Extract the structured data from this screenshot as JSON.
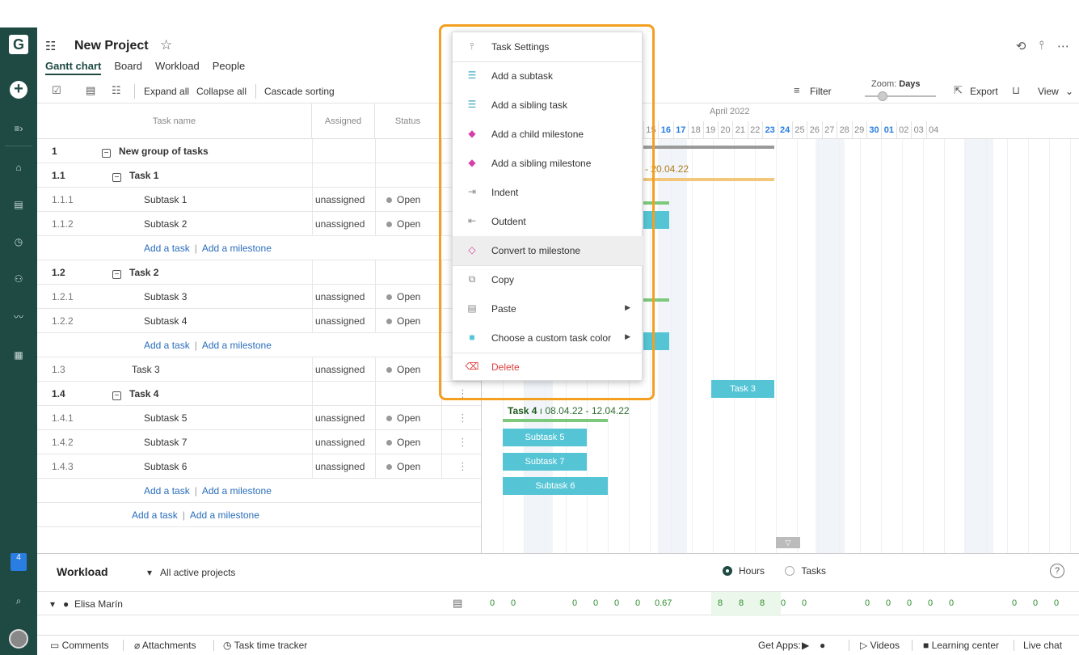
{
  "app": {
    "logo_letter": "G"
  },
  "header": {
    "title": "New Project",
    "tabs": [
      {
        "label": "Gantt chart",
        "active": true
      },
      {
        "label": "Board"
      },
      {
        "label": "Workload"
      },
      {
        "label": "People"
      }
    ]
  },
  "toolbar": {
    "expand_all": "Expand all",
    "collapse_all": "Collapse all",
    "cascade_sorting": "Cascade sorting",
    "filter": "Filter",
    "zoom_label": "Zoom:",
    "zoom_value": "Days",
    "export": "Export",
    "view": "View"
  },
  "grid": {
    "columns": {
      "task_name": "Task name",
      "assigned": "Assigned",
      "status": "Status"
    },
    "rows": [
      {
        "num": "1",
        "name": "New group of tasks",
        "bold": true,
        "collapsible": true,
        "indent": 0
      },
      {
        "num": "1.1",
        "name": "Task 1",
        "bold": true,
        "collapsible": true,
        "indent": 1
      },
      {
        "num": "1.1.1",
        "name": "Subtask 1",
        "assigned": "unassigned",
        "status": "Open",
        "indent": 2
      },
      {
        "num": "1.1.2",
        "name": "Subtask 2",
        "assigned": "unassigned",
        "status": "Open",
        "indent": 2
      },
      {
        "links": true,
        "add_task": "Add a task",
        "add_milestone": "Add a milestone",
        "indent": 2
      },
      {
        "num": "1.2",
        "name": "Task 2",
        "bold": true,
        "collapsible": true,
        "indent": 1
      },
      {
        "num": "1.2.1",
        "name": "Subtask 3",
        "assigned": "unassigned",
        "status": "Open",
        "indent": 2
      },
      {
        "num": "1.2.2",
        "name": "Subtask 4",
        "assigned": "unassigned",
        "status": "Open",
        "indent": 2
      },
      {
        "links": true,
        "add_task": "Add a task",
        "add_milestone": "Add a milestone",
        "indent": 2
      },
      {
        "num": "1.3",
        "name": "Task 3",
        "assigned": "unassigned",
        "status": "Open",
        "indent": 1
      },
      {
        "num": "1.4",
        "name": "Task 4",
        "bold": true,
        "collapsible": true,
        "indent": 1
      },
      {
        "num": "1.4.1",
        "name": "Subtask 5",
        "assigned": "unassigned",
        "status": "Open",
        "indent": 2
      },
      {
        "num": "1.4.2",
        "name": "Subtask 7",
        "assigned": "unassigned",
        "status": "Open",
        "indent": 2
      },
      {
        "num": "1.4.3",
        "name": "Subtask 6",
        "assigned": "unassigned",
        "status": "Open",
        "indent": 2
      },
      {
        "links": true,
        "add_task": "Add a task",
        "add_milestone": "Add a milestone",
        "indent": 2
      },
      {
        "links": true,
        "add_task": "Add a task",
        "add_milestone": "Add a milestone",
        "indent": 1
      }
    ]
  },
  "gantt": {
    "month": "April 2022",
    "days": [
      "15",
      "16",
      "17",
      "18",
      "19",
      "20",
      "21",
      "22",
      "23",
      "24",
      "25",
      "26",
      "27",
      "28",
      "29",
      "30",
      "01",
      "02",
      "03",
      "04"
    ],
    "highlight_days": [
      "16",
      "17",
      "23",
      "24",
      "30",
      "01"
    ],
    "group_end_label": "- 20.04.22",
    "task3_bar": "Task 3",
    "task4_label_name": "Task 4",
    "task4_label_dates": "08.04.22 - 12.04.22",
    "subtask5": "Subtask 5",
    "subtask7": "Subtask 7",
    "subtask6": "Subtask 6"
  },
  "context_menu": {
    "items": [
      {
        "label": "Task Settings",
        "icon": "sliders-icon"
      },
      {
        "label": "Add a subtask",
        "icon": "subtask-icon"
      },
      {
        "label": "Add a sibling task",
        "icon": "sibling-task-icon"
      },
      {
        "label": "Add a child milestone",
        "icon": "child-milestone-icon"
      },
      {
        "label": "Add a sibling milestone",
        "icon": "sibling-milestone-icon"
      },
      {
        "label": "Indent",
        "icon": "indent-icon"
      },
      {
        "label": "Outdent",
        "icon": "outdent-icon"
      },
      {
        "label": "Convert to milestone",
        "icon": "milestone-icon"
      },
      {
        "label": "Copy",
        "icon": "copy-icon"
      },
      {
        "label": "Paste",
        "icon": "paste-icon"
      },
      {
        "label": "Choose a custom task color",
        "icon": "color-swatch-icon"
      },
      {
        "label": "Delete",
        "icon": "trash-icon"
      }
    ]
  },
  "workload": {
    "title": "Workload",
    "projects": "All active projects",
    "hours": "Hours",
    "tasks": "Tasks",
    "help": "?",
    "user": "Elisa Marín",
    "values": [
      "0",
      "0",
      "0",
      "0",
      "0",
      "0",
      "0.67",
      "8",
      "8",
      "8",
      "0",
      "0",
      "0",
      "0",
      "0",
      "0",
      "0",
      "0",
      "0",
      "0"
    ]
  },
  "footer": {
    "comments": "Comments",
    "attachments": "Attachments",
    "time_tracker": "Task time tracker",
    "get_apps": "Get Apps:",
    "videos": "Videos",
    "learning": "Learning center",
    "live_chat": "Live chat"
  },
  "notifications": {
    "count": "4"
  },
  "colors": {
    "rail": "#1f4a44",
    "bar": "#55c5d6",
    "highlight": "#f3a021",
    "milestone": "#d63fa8",
    "delete": "#e04040"
  }
}
